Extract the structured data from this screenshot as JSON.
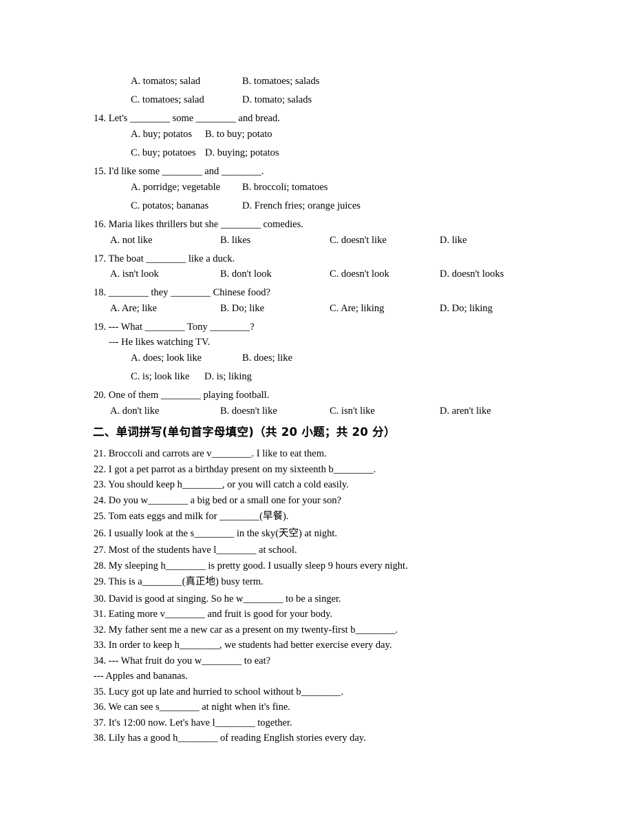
{
  "q13": {
    "options": [
      "A. tomatos; salad",
      "B. tomatoes; salads",
      "C. tomatoes; salad",
      "D. tomato; salads"
    ]
  },
  "q14": {
    "stem": "14. Let's ________ some ________ and bread.",
    "options": [
      "A. buy; potatos",
      "B. to buy; potato",
      "C. buy; potatoes",
      "D. buying; potatos"
    ]
  },
  "q15": {
    "stem": "15. I'd like some ________ and ________.",
    "options": [
      "A. porridge; vegetable",
      "B. broccoli; tomatoes",
      "C. potatos; bananas",
      "D. French fries; orange juices"
    ]
  },
  "q16": {
    "stem": "16. Maria likes thrillers but she ________ comedies.",
    "options": [
      "A. not like",
      "B. likes",
      "C. doesn't like",
      "D. like"
    ]
  },
  "q17": {
    "stem": "17. The boat ________ like a duck.",
    "options": [
      "A. isn't look",
      "B. don't look",
      "C. doesn't look",
      "D. doesn't looks"
    ]
  },
  "q18": {
    "stem": "18. ________ they ________ Chinese food?",
    "options": [
      "A. Are; like",
      "B. Do; like",
      "C. Are; liking",
      "D. Do; liking"
    ]
  },
  "q19": {
    "stem": "19. --- What ________ Tony ________?",
    "stem2": "--- He likes watching TV.",
    "options": [
      "A. does; look like",
      "B. does; like",
      "C. is; look like",
      "D. is; liking"
    ]
  },
  "q20": {
    "stem": "20. One of them ________ playing football.",
    "options": [
      "A. don't like",
      "B. doesn't like",
      "C. isn't like",
      "D. aren't like"
    ]
  },
  "section2": {
    "heading": "二、单词拼写(单句首字母填空)（共 20 小题；共 20 分）",
    "items": [
      "21. Broccoli and carrots are v________. I like to eat them.",
      "22. I got a pet parrot as a birthday present on my sixteenth b________.",
      "23. You should keep h________, or you will catch a cold easily.",
      "24. Do you w________ a big bed or a small one for your son?",
      "25. Tom eats eggs and milk for ________(早餐).",
      "26. I usually look at the s________ in the sky(天空) at night.",
      "27. Most of the students have l________ at school.",
      "28. My sleeping h________ is pretty good. I usually sleep 9 hours every night.",
      "29. This is a________(真正地) busy term.",
      "30. David is good at singing. So he w________ to be a singer.",
      "31. Eating more v________ and fruit is good for your body.",
      "32. My father sent me a new car as a present on my twenty-first b________.",
      "33. In order to keep h________, we students had better exercise every day.",
      "34. --- What fruit do you w________ to eat?",
      "--- Apples and bananas.",
      "35. Lucy got up late and hurried to school without b________.",
      "36. We can see s________ at night when it's fine.",
      "37. It's 12:00 now. Let's have l________ together.",
      "38. Lily has a good h________ of reading English stories every day."
    ]
  }
}
